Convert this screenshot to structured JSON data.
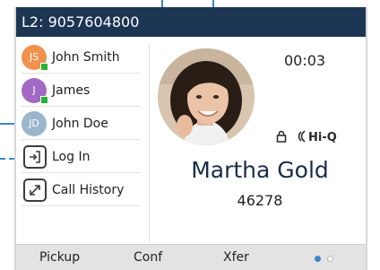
{
  "status_bar": {
    "line_label": "L2: 9057604800"
  },
  "sidebar": {
    "items": [
      {
        "type": "contact",
        "initials": "JS",
        "label": "John Smith",
        "avatar_color": "#f0924e",
        "presence": true
      },
      {
        "type": "contact",
        "initials": "J",
        "label": "James",
        "avatar_color": "#a26ac4",
        "presence": true
      },
      {
        "type": "contact",
        "initials": "JD",
        "label": "John Doe",
        "avatar_color": "#9bb5cc",
        "presence": false
      },
      {
        "type": "key",
        "icon": "login-icon",
        "label": "Log In"
      },
      {
        "type": "key",
        "icon": "call-history-icon",
        "label": "Call History"
      }
    ]
  },
  "call": {
    "timer": "00:03",
    "hiq_label": "Hi-Q",
    "caller_name": "Martha Gold",
    "caller_number": "46278"
  },
  "softkeys": [
    "Pickup",
    "Conf",
    "Xfer"
  ],
  "page_indicator": {
    "active_page": 1,
    "total_pages": 2
  },
  "colors": {
    "status_bar_bg": "#1c3553",
    "presence": "#25b533",
    "accent_blue": "#3a86c8",
    "softkey_bar_bg": "#e3e3e3"
  }
}
